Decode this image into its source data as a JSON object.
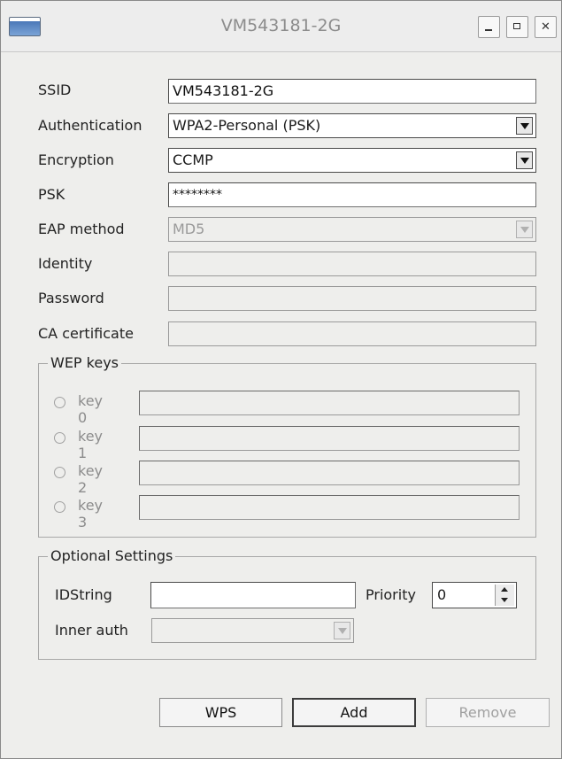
{
  "window": {
    "title": "VM543181-2G",
    "icons": [
      "app-icon",
      "minimize-icon",
      "maximize-icon",
      "close-icon"
    ]
  },
  "form": {
    "ssid": {
      "label": "SSID",
      "value": "VM543181-2G"
    },
    "authentication": {
      "label": "Authentication",
      "value": "WPA2-Personal (PSK)"
    },
    "encryption": {
      "label": "Encryption",
      "value": "CCMP"
    },
    "psk": {
      "label": "PSK",
      "value": "********"
    },
    "eap_method": {
      "label": "EAP method",
      "value": "MD5"
    },
    "identity": {
      "label": "Identity",
      "value": ""
    },
    "password": {
      "label": "Password",
      "value": ""
    },
    "ca_certificate": {
      "label": "CA certificate",
      "value": ""
    }
  },
  "wep": {
    "title": "WEP keys",
    "keys": [
      {
        "label": "key 0",
        "value": ""
      },
      {
        "label": "key 1",
        "value": ""
      },
      {
        "label": "key 2",
        "value": ""
      },
      {
        "label": "key 3",
        "value": ""
      }
    ]
  },
  "optional": {
    "title": "Optional Settings",
    "idstring_label": "IDString",
    "idstring_value": "",
    "priority_label": "Priority",
    "priority_value": "0",
    "inner_auth_label": "Inner auth",
    "inner_auth_value": ""
  },
  "buttons": {
    "wps": "WPS",
    "add": "Add",
    "remove": "Remove"
  },
  "colors": {
    "window_bg": "#eeeeec",
    "disabled_text": "#9a9a9a"
  }
}
